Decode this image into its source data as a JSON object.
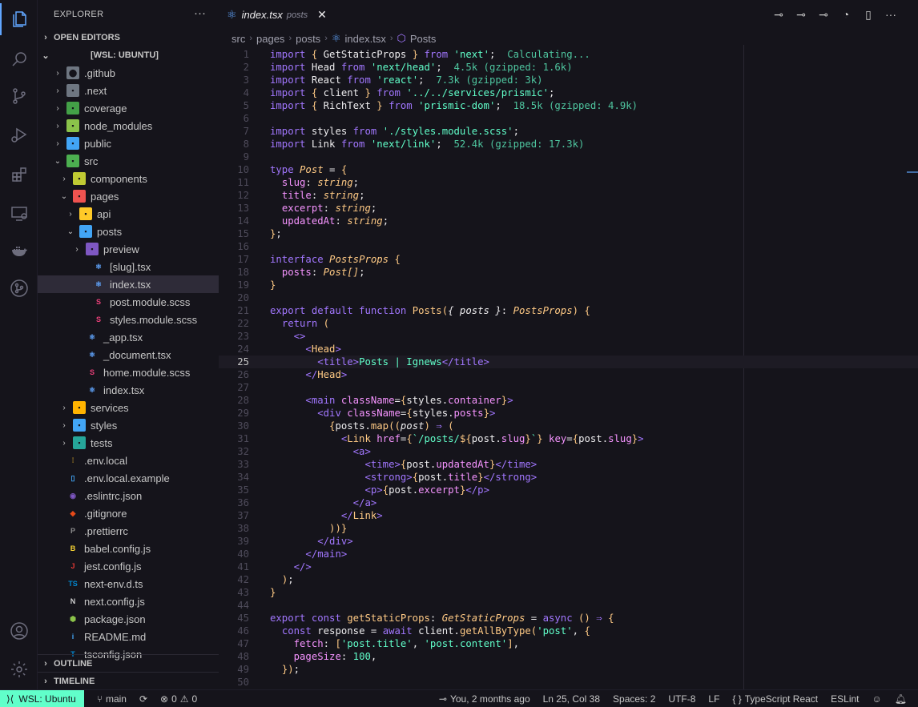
{
  "activity_bar": {
    "items": [
      {
        "name": "explorer",
        "icon": "files-icon",
        "active": true
      },
      {
        "name": "search",
        "icon": "search-icon"
      },
      {
        "name": "source-control",
        "icon": "source-control-icon"
      },
      {
        "name": "run-debug",
        "icon": "debug-icon"
      },
      {
        "name": "extensions",
        "icon": "extensions-icon"
      },
      {
        "name": "remote-explorer",
        "icon": "remote-explorer-icon"
      },
      {
        "name": "docker",
        "icon": "docker-icon"
      },
      {
        "name": "git-graph",
        "icon": "git-graph-icon"
      }
    ],
    "bottom": [
      {
        "name": "accounts",
        "icon": "account-icon"
      },
      {
        "name": "manage",
        "icon": "gear-icon"
      }
    ]
  },
  "sidebar": {
    "title": "EXPLORER",
    "more": "···",
    "open_editors": "OPEN EDITORS",
    "workspace": "[WSL: UBUNTU]",
    "outline": "OUTLINE",
    "timeline": "TIMELINE",
    "tree": [
      {
        "label": ".github",
        "kind": "folder",
        "icon_color": "#6e7681",
        "icon_char": "⬤",
        "depth": 0
      },
      {
        "label": ".next",
        "kind": "folder",
        "icon_color": "#6e7681",
        "icon_char": "▪",
        "depth": 0
      },
      {
        "label": "coverage",
        "kind": "folder",
        "icon_color": "#43a047",
        "icon_char": "▪",
        "depth": 0
      },
      {
        "label": "node_modules",
        "kind": "folder",
        "icon_color": "#8bc34a",
        "icon_char": "▪",
        "depth": 0
      },
      {
        "label": "public",
        "kind": "folder",
        "icon_color": "#42a5f5",
        "icon_char": "▪",
        "depth": 0
      },
      {
        "label": "src",
        "kind": "folder-open",
        "icon_color": "#4caf50",
        "icon_char": "▪",
        "depth": 0
      },
      {
        "label": "components",
        "kind": "folder",
        "icon_color": "#c0ca33",
        "icon_char": "▪",
        "depth": 1
      },
      {
        "label": "pages",
        "kind": "folder-open",
        "icon_color": "#ef5350",
        "icon_char": "▪",
        "depth": 1
      },
      {
        "label": "api",
        "kind": "folder",
        "icon_color": "#ffca28",
        "icon_char": "▪",
        "depth": 2
      },
      {
        "label": "posts",
        "kind": "folder-open",
        "icon_color": "#42a5f5",
        "icon_char": "▪",
        "depth": 2
      },
      {
        "label": "preview",
        "kind": "folder",
        "icon_color": "#7e57c2",
        "icon_char": "▪",
        "depth": 3
      },
      {
        "label": "[slug].tsx",
        "kind": "file",
        "icon_color": "#61a6ff",
        "icon_char": "⚛",
        "depth": 3
      },
      {
        "label": "index.tsx",
        "kind": "file",
        "icon_color": "#61a6ff",
        "icon_char": "⚛",
        "depth": 3,
        "selected": true
      },
      {
        "label": "post.module.scss",
        "kind": "file",
        "icon_color": "#ec407a",
        "icon_char": "S",
        "depth": 3
      },
      {
        "label": "styles.module.scss",
        "kind": "file",
        "icon_color": "#ec407a",
        "icon_char": "S",
        "depth": 3
      },
      {
        "label": "_app.tsx",
        "kind": "file",
        "icon_color": "#61a6ff",
        "icon_char": "⚛",
        "depth": 2
      },
      {
        "label": "_document.tsx",
        "kind": "file",
        "icon_color": "#61a6ff",
        "icon_char": "⚛",
        "depth": 2
      },
      {
        "label": "home.module.scss",
        "kind": "file",
        "icon_color": "#ec407a",
        "icon_char": "S",
        "depth": 2
      },
      {
        "label": "index.tsx",
        "kind": "file",
        "icon_color": "#61a6ff",
        "icon_char": "⚛",
        "depth": 2
      },
      {
        "label": "services",
        "kind": "folder",
        "icon_color": "#ffb300",
        "icon_char": "▪",
        "depth": 1
      },
      {
        "label": "styles",
        "kind": "folder",
        "icon_color": "#42a5f5",
        "icon_char": "▪",
        "depth": 1
      },
      {
        "label": "tests",
        "kind": "folder",
        "icon_color": "#26a69a",
        "icon_char": "▪",
        "depth": 1
      },
      {
        "label": ".env.local",
        "kind": "file",
        "icon_color": "#fbc02d",
        "icon_char": "⫶",
        "depth": 0
      },
      {
        "label": ".env.local.example",
        "kind": "file",
        "icon_color": "#42a5f5",
        "icon_char": "▯",
        "depth": 0
      },
      {
        "label": ".eslintrc.json",
        "kind": "file",
        "icon_color": "#7e57c2",
        "icon_char": "◉",
        "depth": 0
      },
      {
        "label": ".gitignore",
        "kind": "file",
        "icon_color": "#e64a19",
        "icon_char": "◆",
        "depth": 0
      },
      {
        "label": ".prettierrc",
        "kind": "file",
        "icon_color": "#8d8d8d",
        "icon_char": "P",
        "depth": 0
      },
      {
        "label": "babel.config.js",
        "kind": "file",
        "icon_color": "#fdd835",
        "icon_char": "B",
        "depth": 0
      },
      {
        "label": "jest.config.js",
        "kind": "file",
        "icon_color": "#e53935",
        "icon_char": "J",
        "depth": 0
      },
      {
        "label": "next-env.d.ts",
        "kind": "file",
        "icon_color": "#0288d1",
        "icon_char": "TS",
        "depth": 0
      },
      {
        "label": "next.config.js",
        "kind": "file",
        "icon_color": "#cfcfcf",
        "icon_char": "N",
        "depth": 0
      },
      {
        "label": "package.json",
        "kind": "file",
        "icon_color": "#8bc34a",
        "icon_char": "⬢",
        "depth": 0
      },
      {
        "label": "README.md",
        "kind": "file",
        "icon_color": "#42a5f5",
        "icon_char": "i",
        "depth": 0
      },
      {
        "label": "tsconfig.json",
        "kind": "file",
        "icon_color": "#0288d1",
        "icon_char": "T",
        "depth": 0
      }
    ]
  },
  "tab": {
    "name": "index.tsx",
    "description": "posts",
    "close": "✕",
    "icon": "react-icon"
  },
  "breadcrumb": [
    "src",
    "pages",
    "posts",
    "index.tsx",
    "Posts"
  ],
  "editor": {
    "current_line": 25,
    "lines": [
      {
        "n": "1",
        "html": "<span class='k'>import</span> <span class='p'>{</span> GetStaticProps <span class='p'>}</span> <span class='k'>from</span> <span class='s'>'next'</span>;  <span class='sz'>Calculating...</span>"
      },
      {
        "n": "2",
        "html": "<span class='k'>import</span> Head <span class='k'>from</span> <span class='s'>'next/head'</span>;  <span class='sz'>4.5k (gzipped: 1.6k)</span>"
      },
      {
        "n": "3",
        "html": "<span class='k'>import</span> React <span class='k'>from</span> <span class='s'>'react'</span>;  <span class='sz'>7.3k (gzipped: 3k)</span>"
      },
      {
        "n": "4",
        "html": "<span class='k'>import</span> <span class='p'>{</span> client <span class='p'>}</span> <span class='k'>from</span> <span class='s'>'../../services/prismic'</span>;"
      },
      {
        "n": "5",
        "html": "<span class='k'>import</span> <span class='p'>{</span> RichText <span class='p'>}</span> <span class='k'>from</span> <span class='s'>'prismic-dom'</span>;  <span class='sz'>18.5k (gzipped: 4.9k)</span>"
      },
      {
        "n": "6",
        "html": ""
      },
      {
        "n": "7",
        "html": "<span class='k'>import</span> styles <span class='k'>from</span> <span class='s'>'./styles.module.scss'</span>;"
      },
      {
        "n": "8",
        "html": "<span class='k'>import</span> Link <span class='k'>from</span> <span class='s'>'next/link'</span>;  <span class='sz'>52.4k (gzipped: 17.3k)</span>"
      },
      {
        "n": "9",
        "html": ""
      },
      {
        "n": "10",
        "html": "<span class='k'>type</span> <span class='t'>Post</span> = <span class='p'>{</span>"
      },
      {
        "n": "11",
        "html": "  <span class='prop'>slug</span>: <span class='t'>string</span>;"
      },
      {
        "n": "12",
        "html": "  <span class='prop'>title</span>: <span class='t'>string</span>;"
      },
      {
        "n": "13",
        "html": "  <span class='prop'>excerpt</span>: <span class='t'>string</span>;"
      },
      {
        "n": "14",
        "html": "  <span class='prop'>updatedAt</span>: <span class='t'>string</span>;"
      },
      {
        "n": "15",
        "html": "<span class='p'>}</span>;"
      },
      {
        "n": "16",
        "html": ""
      },
      {
        "n": "17",
        "html": "<span class='k'>interface</span> <span class='t'>PostsProps</span> <span class='p'>{</span>"
      },
      {
        "n": "18",
        "html": "  <span class='prop'>posts</span>: <span class='t'>Post[]</span>;"
      },
      {
        "n": "19",
        "html": "<span class='p'>}</span>"
      },
      {
        "n": "20",
        "html": ""
      },
      {
        "n": "21",
        "html": "<span class='k'>export default function</span> <span class='f'>Posts</span><span class='p'>(</span><span class='it'>{ posts }</span>: <span class='t'>PostsProps</span><span class='p'>)</span> <span class='p'>{</span>"
      },
      {
        "n": "22",
        "html": "  <span class='k'>return</span> <span class='p'>(</span>"
      },
      {
        "n": "23",
        "html": "    <span class='tag'>&lt;&gt;</span>"
      },
      {
        "n": "24",
        "html": "      <span class='tag'>&lt;</span><span class='f'>Head</span><span class='tag'>&gt;</span>"
      },
      {
        "n": "25",
        "html": "        <span class='tag'>&lt;title&gt;</span><span class='s'>Posts | Ignews</span><span class='tag'>&lt;/title&gt;</span>"
      },
      {
        "n": "26",
        "html": "      <span class='tag'>&lt;/</span><span class='f'>Head</span><span class='tag'>&gt;</span>"
      },
      {
        "n": "27",
        "html": ""
      },
      {
        "n": "28",
        "html": "      <span class='tag'>&lt;main</span> <span class='attr'>className</span>=<span class='p'>{</span>styles.<span class='prop'>container</span><span class='p'>}</span><span class='tag'>&gt;</span>"
      },
      {
        "n": "29",
        "html": "        <span class='tag'>&lt;div</span> <span class='attr'>className</span>=<span class='p'>{</span>styles.<span class='prop'>posts</span><span class='p'>}</span><span class='tag'>&gt;</span>"
      },
      {
        "n": "30",
        "html": "          <span class='p'>{</span>posts.<span class='f'>map</span><span class='p'>((</span><span class='it'>post</span><span class='p'>)</span> <span class='k'>⇒</span> <span class='p'>(</span>"
      },
      {
        "n": "31",
        "html": "            <span class='tag'>&lt;</span><span class='f'>Link</span> <span class='attr'>href</span>=<span class='p'>{</span><span class='s'>`/posts/</span><span class='p'>${</span>post.<span class='prop'>slug</span><span class='p'>}</span><span class='s'>`</span><span class='p'>}</span> <span class='attr'>key</span>=<span class='p'>{</span>post.<span class='prop'>slug</span><span class='p'>}</span><span class='tag'>&gt;</span>"
      },
      {
        "n": "32",
        "html": "              <span class='tag'>&lt;a&gt;</span>"
      },
      {
        "n": "33",
        "html": "                <span class='tag'>&lt;time&gt;</span><span class='p'>{</span>post.<span class='prop'>updatedAt</span><span class='p'>}</span><span class='tag'>&lt;/time&gt;</span>"
      },
      {
        "n": "34",
        "html": "                <span class='tag'>&lt;strong&gt;</span><span class='p'>{</span>post.<span class='prop'>title</span><span class='p'>}</span><span class='tag'>&lt;/strong&gt;</span>"
      },
      {
        "n": "35",
        "html": "                <span class='tag'>&lt;p&gt;</span><span class='p'>{</span>post.<span class='prop'>excerpt</span><span class='p'>}</span><span class='tag'>&lt;/p&gt;</span>"
      },
      {
        "n": "36",
        "html": "              <span class='tag'>&lt;/a&gt;</span>"
      },
      {
        "n": "37",
        "html": "            <span class='tag'>&lt;/</span><span class='f'>Link</span><span class='tag'>&gt;</span>"
      },
      {
        "n": "38",
        "html": "          <span class='p'>))}</span>"
      },
      {
        "n": "39",
        "html": "        <span class='tag'>&lt;/div&gt;</span>"
      },
      {
        "n": "40",
        "html": "      <span class='tag'>&lt;/main&gt;</span>"
      },
      {
        "n": "41",
        "html": "    <span class='tag'>&lt;/&gt;</span>"
      },
      {
        "n": "42",
        "html": "  <span class='p'>)</span>;"
      },
      {
        "n": "43",
        "html": "<span class='p'>}</span>"
      },
      {
        "n": "44",
        "html": ""
      },
      {
        "n": "45",
        "html": "<span class='k'>export const</span> <span class='f'>getStaticProps</span>: <span class='t'>GetStaticProps</span> = <span class='k'>async</span> <span class='p'>()</span> <span class='k'>⇒</span> <span class='p'>{</span>"
      },
      {
        "n": "46",
        "html": "  <span class='k'>const</span> response = <span class='k'>await</span> client.<span class='f'>getAllByType</span><span class='p'>(</span><span class='s'>'post'</span>, <span class='p'>{</span>"
      },
      {
        "n": "47",
        "html": "    <span class='prop'>fetch</span>: <span class='p'>[</span><span class='s'>'post.title'</span>, <span class='s'>'post.content'</span><span class='p'>]</span>,"
      },
      {
        "n": "48",
        "html": "    <span class='prop'>pageSize</span>: <span class='s'>100</span>,"
      },
      {
        "n": "49",
        "html": "  <span class='p'>})</span>;"
      },
      {
        "n": "50",
        "html": ""
      }
    ]
  },
  "status_bar": {
    "remote": "WSL: Ubuntu",
    "branch": "main",
    "sync_icon": "sync-icon",
    "problems": "0",
    "warnings": "0",
    "blame": "You, 2 months ago",
    "position": "Ln 25, Col 38",
    "spaces": "Spaces: 2",
    "encoding": "UTF-8",
    "eol": "LF",
    "language": "TypeScript React",
    "linter": "ESLint"
  }
}
